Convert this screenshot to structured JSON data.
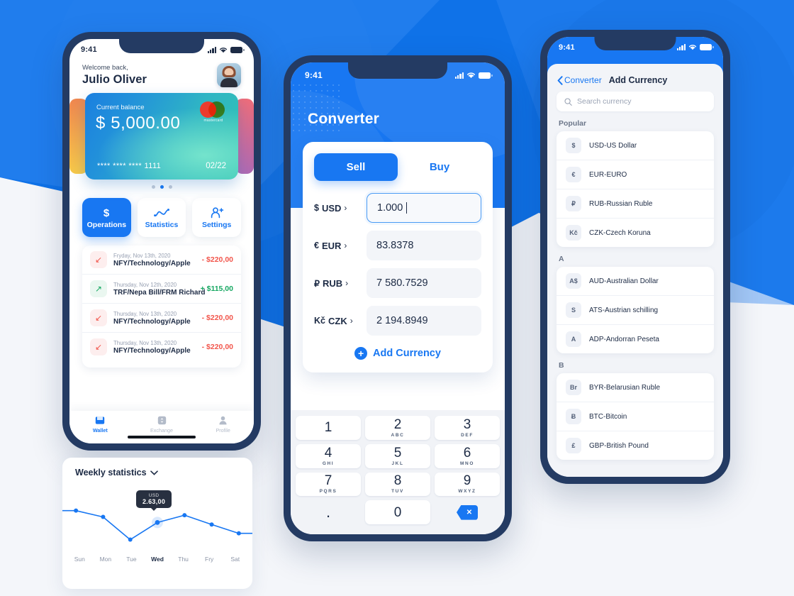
{
  "theme": {
    "brand_blue": "#1877f2",
    "dark_navy": "#243b63",
    "bg_light": "#f4f6fa",
    "negative_red": "#f2564c",
    "positive_green": "#17a862"
  },
  "wallet_phone": {
    "status_bar": {
      "time": "9:41",
      "signal_icon": "cellular-bars-icon",
      "wifi_icon": "wifi-icon",
      "battery_icon": "battery-icon"
    },
    "greeting": {
      "subtitle": "Welcome back,",
      "name": "Julio Oliver"
    },
    "card": {
      "label": "Current balance",
      "amount": "$ 5,000.00",
      "number": "**** **** **** 1111",
      "expiry": "02/22",
      "brand": "mastercard",
      "brand_label": "mastercard"
    },
    "carousel": {
      "total": 3,
      "active_index": 1
    },
    "actions": [
      {
        "label": "Operations",
        "icon": "dollar-icon",
        "active": true
      },
      {
        "label": "Statistics",
        "icon": "line-chart-icon",
        "active": false
      },
      {
        "label": "Settings",
        "icon": "add-user-icon",
        "active": false
      }
    ],
    "transactions": [
      {
        "date": "Fryday, Nov 13th, 2020",
        "description": "NFY/Technology/Apple",
        "amount": "- $220,00",
        "direction": "out"
      },
      {
        "date": "Thursday, Nov 12th, 2020",
        "description": "TRF/Nepa Bill/FRM Richard",
        "amount": "+ $115,00",
        "direction": "in"
      },
      {
        "date": "Thursday, Nov 13th, 2020",
        "description": "NFY/Technology/Apple",
        "amount": "- $220,00",
        "direction": "out"
      },
      {
        "date": "Thursday, Nov 13th, 2020",
        "description": "NFY/Technology/Apple",
        "amount": "- $220,00",
        "direction": "out"
      }
    ],
    "tabbar": [
      {
        "label": "Wallet",
        "icon": "wallet-icon",
        "active": true
      },
      {
        "label": "Exchange",
        "icon": "exchange-icon",
        "active": false
      },
      {
        "label": "Profile",
        "icon": "person-icon",
        "active": false
      }
    ]
  },
  "stats_panel": {
    "title": "Weekly statistics",
    "chevron_icon": "chevron-down-icon",
    "tooltip": {
      "currency": "USD",
      "value": "2.63,00"
    }
  },
  "chart_data": {
    "type": "line",
    "title": "Weekly statistics",
    "categories": [
      "Sun",
      "Mon",
      "Tue",
      "Wed",
      "Thu",
      "Fry",
      "Sat"
    ],
    "values": [
      3.1,
      2.85,
      1.95,
      2.63,
      2.92,
      2.55,
      2.2
    ],
    "highlight_category": "Wed",
    "highlight_value": "2.63,00",
    "highlight_currency": "USD",
    "series": [
      {
        "name": "USD",
        "values": [
          3.1,
          2.85,
          1.95,
          2.63,
          2.92,
          2.55,
          2.2
        ]
      }
    ],
    "xlabel": "",
    "ylabel": "",
    "ylim": [
      1.6,
      3.4
    ],
    "grid": false,
    "legend": "none",
    "line_color": "#1877f2",
    "point_color": "#1877f2"
  },
  "converter_phone": {
    "status_bar": {
      "time": "9:41",
      "signal_icon": "cellular-bars-icon",
      "wifi_icon": "wifi-icon",
      "battery_icon": "battery-icon"
    },
    "title": "Converter",
    "segments": [
      {
        "label": "Sell",
        "active": true
      },
      {
        "label": "Buy",
        "active": false
      }
    ],
    "rows": [
      {
        "symbol": "$",
        "code": "USD",
        "value": "1.000",
        "focused": true
      },
      {
        "symbol": "€",
        "code": "EUR",
        "value": "83.8378",
        "focused": false
      },
      {
        "symbol": "₽",
        "code": "RUB",
        "value": "7 580.7529",
        "focused": false
      },
      {
        "symbol": "Kč",
        "code": "CZK",
        "value": "2 194.8949",
        "focused": false
      }
    ],
    "add_currency": {
      "label": "Add Currency",
      "icon": "plus-circle-icon"
    },
    "keypad": [
      {
        "num": "1",
        "letters": ""
      },
      {
        "num": "2",
        "letters": "ABC"
      },
      {
        "num": "3",
        "letters": "DEF"
      },
      {
        "num": "4",
        "letters": "GHI"
      },
      {
        "num": "5",
        "letters": "JKL"
      },
      {
        "num": "6",
        "letters": "MNO"
      },
      {
        "num": "7",
        "letters": "PQRS"
      },
      {
        "num": "8",
        "letters": "TUV"
      },
      {
        "num": "9",
        "letters": "WXYZ"
      },
      {
        "num": ".",
        "letters": ""
      },
      {
        "num": "0",
        "letters": ""
      },
      {
        "num": "",
        "letters": "",
        "icon": "backspace-icon"
      }
    ]
  },
  "add_currency_phone": {
    "status_bar": {
      "time": "9:41",
      "signal_icon": "cellular-bars-icon",
      "wifi_icon": "wifi-icon",
      "battery_icon": "battery-icon"
    },
    "back_label": "Converter",
    "back_icon": "chevron-left-icon",
    "heading": "Add Currency",
    "search": {
      "placeholder": "Search currency",
      "icon": "search-icon",
      "value": ""
    },
    "sections": [
      {
        "header": "Popular",
        "items": [
          {
            "badge": "$",
            "name": "USD-US Dollar"
          },
          {
            "badge": "€",
            "name": "EUR-EURO"
          },
          {
            "badge": "₽",
            "name": "RUB-Russian Ruble"
          },
          {
            "badge": "Kč",
            "name": "CZK-Czech Koruna"
          }
        ]
      },
      {
        "header": "A",
        "items": [
          {
            "badge": "A$",
            "name": "AUD-Australian Dollar"
          },
          {
            "badge": "S",
            "name": "ATS-Austrian schilling"
          },
          {
            "badge": "A",
            "name": "ADP-Andorran Peseta"
          }
        ]
      },
      {
        "header": "B",
        "items": [
          {
            "badge": "Br",
            "name": "BYR-Belarusian Ruble"
          },
          {
            "badge": "Ƀ",
            "name": "BTC-Bitcoin"
          },
          {
            "badge": "₤",
            "name": "GBP-British Pound"
          }
        ]
      }
    ]
  }
}
